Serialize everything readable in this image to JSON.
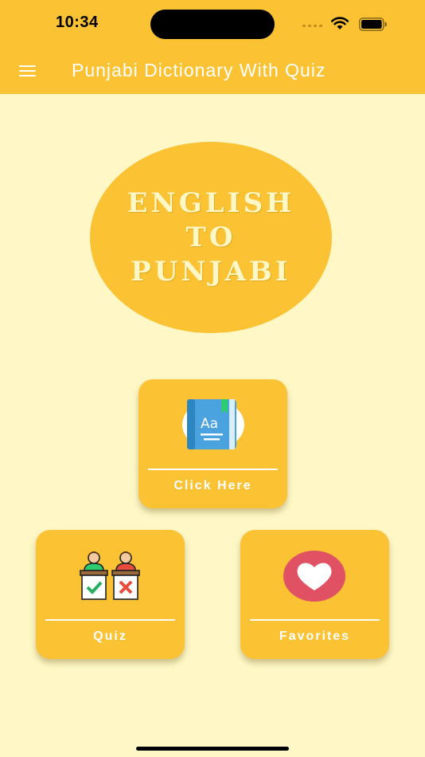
{
  "status_bar": {
    "time": "10:34"
  },
  "app_bar": {
    "title": "Punjabi Dictionary With Quiz",
    "menu_icon": "hamburger-menu-icon"
  },
  "hero": {
    "lines": [
      "ENGLISH",
      "TO",
      "PUNJABI"
    ]
  },
  "cards": {
    "dictionary": {
      "label": "Click Here",
      "icon": "dictionary-book-icon"
    },
    "quiz": {
      "label": "Quiz",
      "icon": "quiz-podium-icon"
    },
    "favorites": {
      "label": "Favorites",
      "icon": "heart-icon"
    }
  },
  "colors": {
    "accent": "#fbc234",
    "background": "#fff8c6",
    "heart": "#e05263",
    "book": "#4aa3df"
  }
}
